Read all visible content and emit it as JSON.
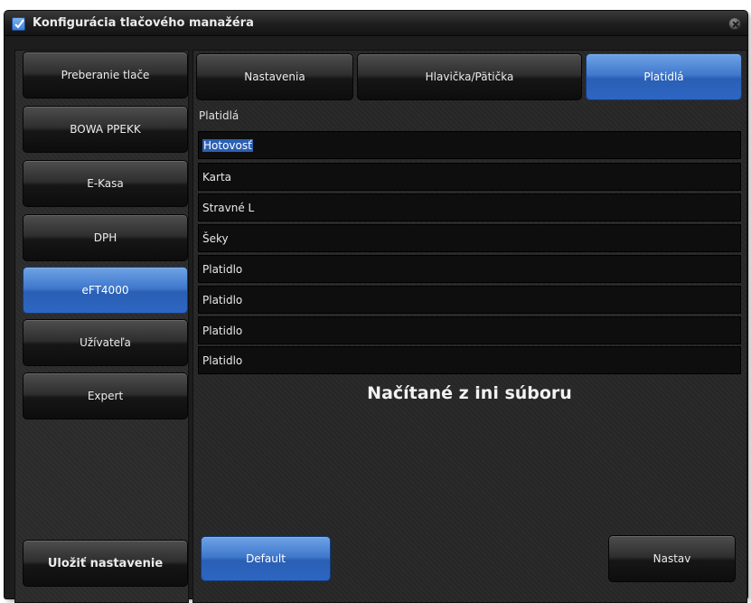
{
  "window": {
    "title": "Konfigurácia tlačového manažéra"
  },
  "sidebar": {
    "items": [
      {
        "label": "Preberanie tlače",
        "active": false
      },
      {
        "label": "BOWA PPEKK",
        "active": false
      },
      {
        "label": "E-Kasa",
        "active": false
      },
      {
        "label": "DPH",
        "active": false
      },
      {
        "label": "eFT4000",
        "active": true
      },
      {
        "label": "Užívateľa",
        "active": false
      },
      {
        "label": "Expert",
        "active": false
      }
    ],
    "save_label": "Uložiť nastavenie"
  },
  "tabs": [
    {
      "label": "Nastavenia",
      "active": false
    },
    {
      "label": "Hlavička/Pätička",
      "active": false
    },
    {
      "label": "Platidlá",
      "active": true
    }
  ],
  "payments": {
    "group_label": "Platidlá",
    "fields": [
      "Hotovosť",
      "Karta",
      "Stravné L",
      "Šeky",
      "Platidlo",
      "Platidlo",
      "Platidlo",
      "Platidlo"
    ],
    "status": "Načítané z ini súboru"
  },
  "footer": {
    "default_label": "Default",
    "set_label": "Nastav"
  },
  "colors": {
    "accent": "#3f78cc",
    "background": "#262626",
    "field_background": "#0e0e0e"
  },
  "icons": {
    "title": "checkbox-icon",
    "close": "close-icon"
  }
}
